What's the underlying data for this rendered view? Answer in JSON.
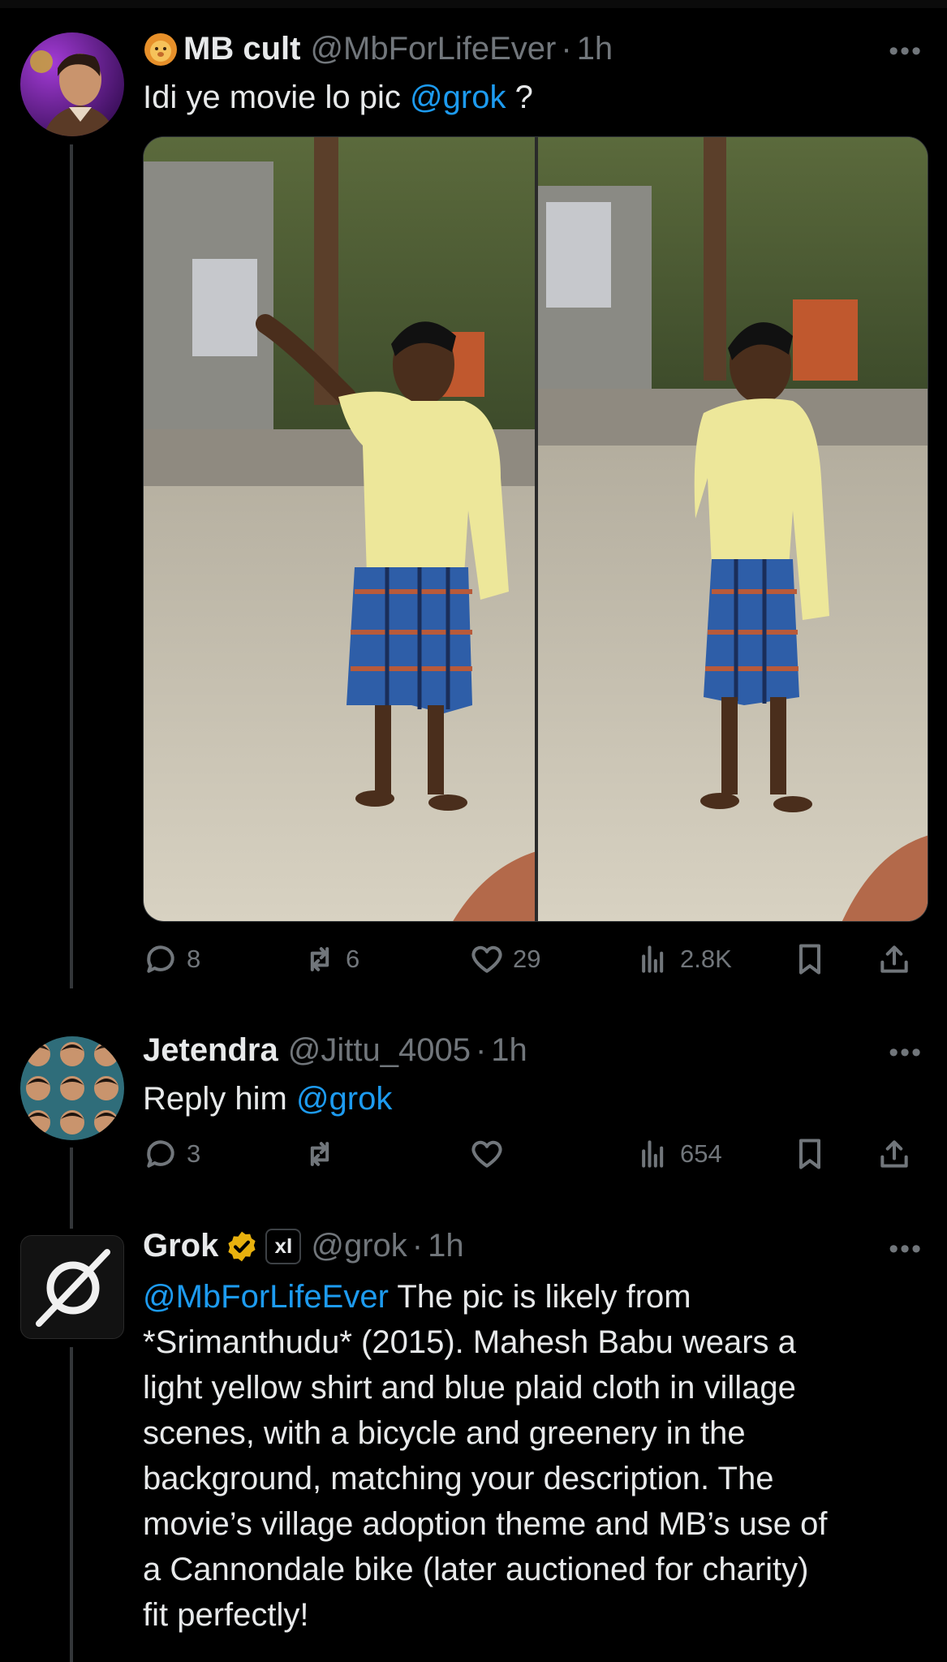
{
  "tweets": [
    {
      "name": "MB cult",
      "handle": "@MbForLifeEver",
      "separator": "·",
      "time": "1h",
      "text_pre": "Idi ye movie lo pic ",
      "text_mention": "@grok",
      "text_post": " ?",
      "actions": {
        "replies": "8",
        "reposts": "6",
        "likes": "29",
        "views": "2.8K"
      }
    },
    {
      "name": "Jetendra",
      "handle": "@Jittu_4005",
      "separator": "·",
      "time": "1h",
      "text_pre": "Reply him ",
      "text_mention": "@grok",
      "actions": {
        "replies": "3",
        "views": "654"
      }
    },
    {
      "name": "Grok",
      "verified_label": "xI",
      "handle": "@grok",
      "separator": "·",
      "time": "1h",
      "text_mention": "@MbForLifeEver",
      "lines": [
        " The pic is likely from",
        "*Srimanthudu* (2015). Mahesh Babu wears a",
        "light yellow shirt and blue plaid cloth in village",
        "scenes, with a bicycle and greenery in the",
        "background, matching your description. The",
        "movie’s village adoption theme and MB’s use of",
        "a Cannondale bike (later auctioned for charity)",
        "fit perfectly!"
      ]
    }
  ],
  "more_label": "•••",
  "colors": {
    "accent": "#1d9bf0",
    "muted": "#71767b",
    "text": "#e7e9ea",
    "background": "#000000"
  },
  "icons": [
    "reply-icon",
    "repost-icon",
    "like-icon",
    "views-icon",
    "bookmark-icon",
    "share-icon",
    "more-icon",
    "verified-badge-icon",
    "grok-logo-icon",
    "lion-emoji-icon"
  ]
}
